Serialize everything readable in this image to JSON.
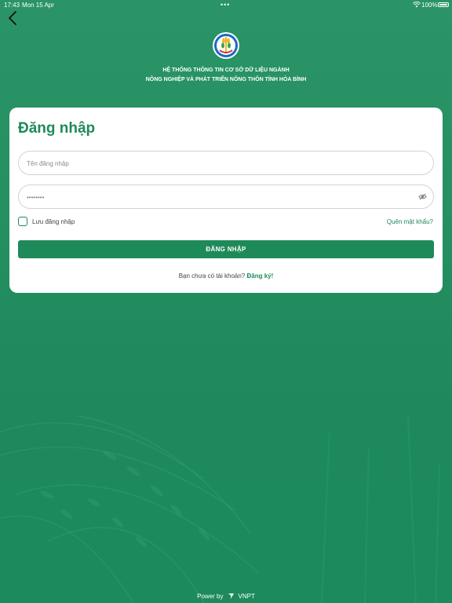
{
  "status_bar": {
    "time": "17:43",
    "date": "Mon 15 Apr",
    "dots": "•••",
    "battery": "100%"
  },
  "header": {
    "title_line1": "HỆ THỐNG THÔNG TIN CƠ SỞ DỮ LIỆU NGÀNH",
    "title_line2": "NÔNG NGHIỆP VÀ PHÁT TRIỂN NÔNG THÔN TỈNH HÒA BÌNH"
  },
  "login": {
    "title": "Đăng nhập",
    "username_placeholder": "Tên đăng nhập",
    "password_value": "••••••••",
    "remember_label": "Lưu đăng nhập",
    "forgot_label": "Quên mật khẩu?",
    "submit_label": "ĐĂNG NHẬP",
    "no_account_text": "Bạn chưa có tài khoản?",
    "signup_label": "Đăng ký!"
  },
  "footer": {
    "power_by": "Power by",
    "brand": "VNPT"
  },
  "colors": {
    "accent": "#1e8a5a",
    "background": "#249163",
    "card": "#ffffff"
  },
  "icons": {
    "back": "chevron-left-icon",
    "logo": "ministry-logo",
    "eye": "eye-slash-icon",
    "wifi": "wifi-icon",
    "battery": "battery-icon",
    "vnpt": "vnpt-logo-icon"
  }
}
